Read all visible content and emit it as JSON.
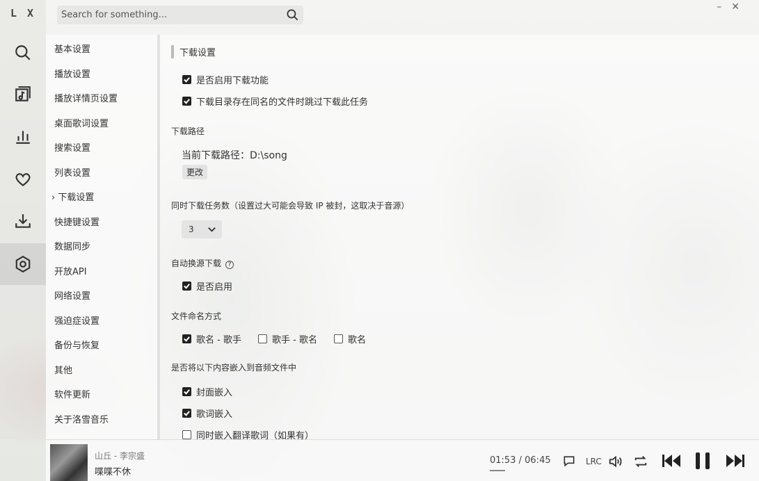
{
  "app": {
    "logo": "L X"
  },
  "search": {
    "placeholder": "Search for something..."
  },
  "window": {
    "minimize": "–",
    "close": "✕"
  },
  "menu": {
    "items": [
      "基本设置",
      "播放设置",
      "播放详情页设置",
      "桌面歌词设置",
      "搜索设置",
      "列表设置",
      "下载设置",
      "快捷键设置",
      "数据同步",
      "开放API",
      "网络设置",
      "强迫症设置",
      "备份与恢复",
      "其他",
      "软件更新",
      "关于洛雪音乐"
    ],
    "active_marker": "›",
    "active_index": 6
  },
  "download": {
    "title": "下载设置",
    "enable_download": "是否启用下载功能",
    "skip_same_name": "下载目录存在同名的文件时跳过下载此任务",
    "path_label": "下载路径",
    "current_path": "当前下载路径：D:\\song",
    "change_button": "更改",
    "concurrent_label": "同时下载任务数（设置过大可能会导致 IP 被封，这取决于音源）",
    "concurrent_value": "3",
    "auto_switch_label": "自动换源下载",
    "auto_switch_help": "?",
    "auto_switch_enable": "是否启用",
    "naming_label": "文件命名方式",
    "naming_options": [
      "歌名 - 歌手",
      "歌手 - 歌名",
      "歌名"
    ],
    "naming_selected": 0,
    "embed_label": "是否将以下内容嵌入到音频文件中",
    "embed_cover": "封面嵌入",
    "embed_lyric": "歌词嵌入",
    "embed_translation": "同时嵌入翻译歌词（如果有）"
  },
  "player": {
    "song_title": "山丘 - 李宗盛",
    "lyric_line": "喋喋不休",
    "time_current": "01:53",
    "time_separator": "/",
    "time_total": "06:45",
    "lrc_label": "LRC",
    "progress": 0.279
  }
}
